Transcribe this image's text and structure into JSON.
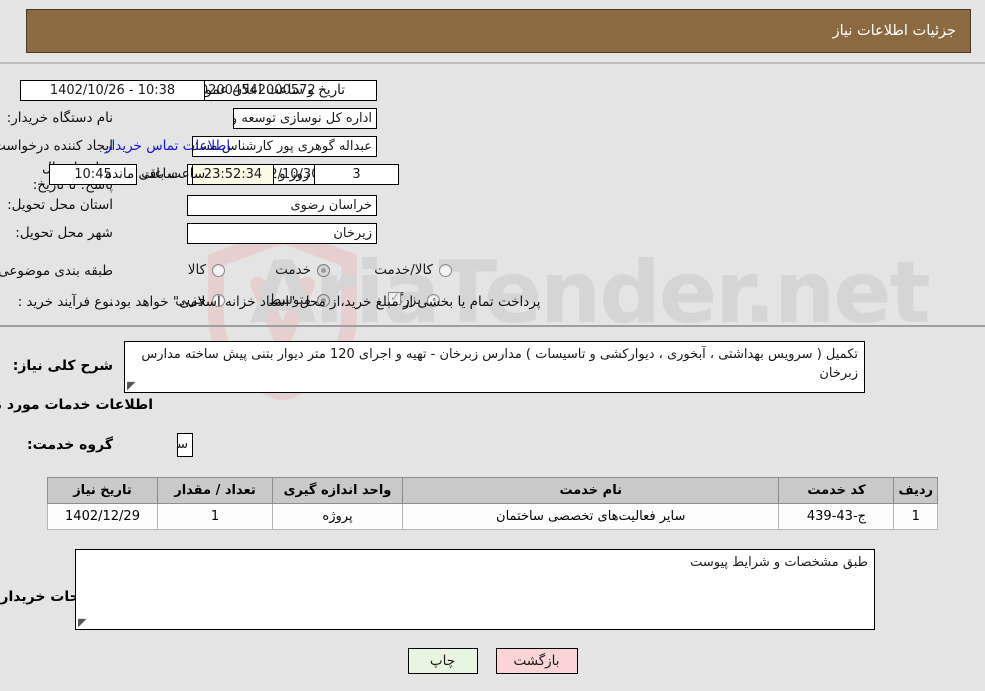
{
  "header": {
    "title": "جزئیات اطلاعات نیاز"
  },
  "watermark": {
    "text": "AriaTender.net"
  },
  "form": {
    "need_number_label": "شماره نیاز:",
    "need_number_value": "1102004542000572",
    "announce_label": "تاریخ و ساعت اعلان عمومی:",
    "announce_value": "10:38 - 1402/10/26",
    "buyer_org_label": "نام دستگاه خریدار:",
    "buyer_org_value": "اداره کل نوسازی  توسعه و تجهیز مدارس استان خراسان رضوی",
    "creator_label": "ایجاد کننده درخواست:",
    "creator_value": "عبداله گوهری پور کارشناس مسئول امور قرارداداها  اداره کل نوسازی  توسعه و ت",
    "contact_link": "اطلاعات تماس خریدار",
    "deadline_label": "مهلت ارسال پاسخ: تا تاریخ:",
    "deadline_date": "1402/10/30",
    "hour_label": "ساعت",
    "hour_value": "10:45",
    "days_value": "3",
    "days_label": "روز و",
    "timer_value": "23:52:34",
    "remaining_label": "ساعت باقی مانده",
    "province_label": "استان محل تحویل:",
    "province_value": "خراسان رضوی",
    "city_label": "شهر محل تحویل:",
    "city_value": "زیرخان",
    "category_label": "طبقه بندی موضوعی:",
    "category_options": [
      {
        "label": "کالا",
        "selected": false
      },
      {
        "label": "خدمت",
        "selected": true
      },
      {
        "label": "کالا/خدمت",
        "selected": false
      }
    ],
    "process_label": "نوع فرآیند خرید :",
    "process_options": [
      {
        "label": "جزیی",
        "selected": false
      },
      {
        "label": "متوسط",
        "selected": true
      },
      {
        "label": "بزرگ",
        "selected": false
      }
    ],
    "treasury_note": "پرداخت تمام یا بخشی از مبلغ خرید،از محل \"اسناد خزانه اسلامی\" خواهد بود."
  },
  "description": {
    "label": "شرح کلی نیاز:",
    "value": "تکمیل ( سرویس بهداشتی ، آبخوری ، دیوارکشی و تاسیسات ) مدارس زبرخان - تهیه و اجرای 120 متر دیوار بتنی پیش ساخته مدارس زبرخان"
  },
  "services": {
    "section_title": "اطلاعات خدمات مورد نیاز",
    "group_label": "گروه خدمت:",
    "group_value": "ساختمان",
    "columns": [
      "ردیف",
      "کد خدمت",
      "نام خدمت",
      "واحد اندازه گیری",
      "تعداد / مقدار",
      "تاریخ نیاز"
    ],
    "rows": [
      {
        "index": "1",
        "code": "ج-43-439",
        "name": "سایر فعالیت‌های تخصصی ساختمان",
        "unit": "پروژه",
        "qty": "1",
        "date": "1402/12/29"
      }
    ]
  },
  "buyer_notes": {
    "label": "توضیحات خریدار:",
    "value": "طبق مشخصات و شرایط پیوست"
  },
  "buttons": {
    "print": "چاپ",
    "back": "بازگشت"
  }
}
